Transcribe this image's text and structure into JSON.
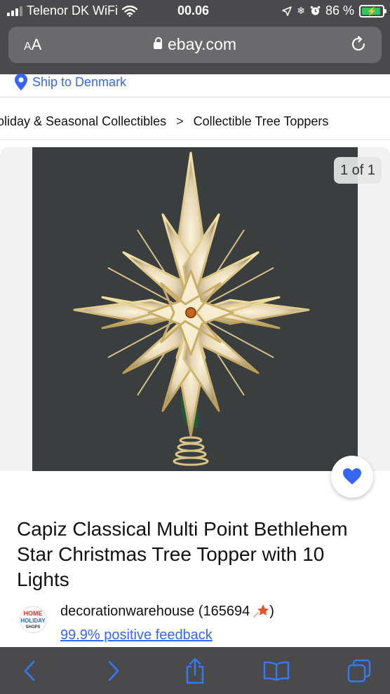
{
  "status_bar": {
    "carrier": "Telenor DK WiFi",
    "time": "00.06",
    "battery_percent": "86 %",
    "battery_level": 0.86
  },
  "browser": {
    "text_size_label_small": "A",
    "text_size_label_large": "A",
    "url": "ebay.com"
  },
  "page": {
    "ship_to": "Ship to Denmark",
    "breadcrumb": [
      "oliday & Seasonal Collectibles",
      "Collectible Tree Toppers"
    ],
    "breadcrumb_separator": ">",
    "image_counter": "1 of 1",
    "title": "Capiz Classical Multi Point Bethlehem Star Christmas Tree Topper with 10 Lights",
    "seller": {
      "name": "decorationwarehouse (165694",
      "name_suffix": ")",
      "feedback": "99.9% positive feedback",
      "logo_text_top": "HOME",
      "logo_text_mid": "HOLIDAY",
      "logo_text_bottom": "SHOPS"
    }
  },
  "colors": {
    "link_blue": "#3665f3",
    "chrome_gray": "#4a4a4c",
    "ios_blue": "#2f7cf6"
  }
}
